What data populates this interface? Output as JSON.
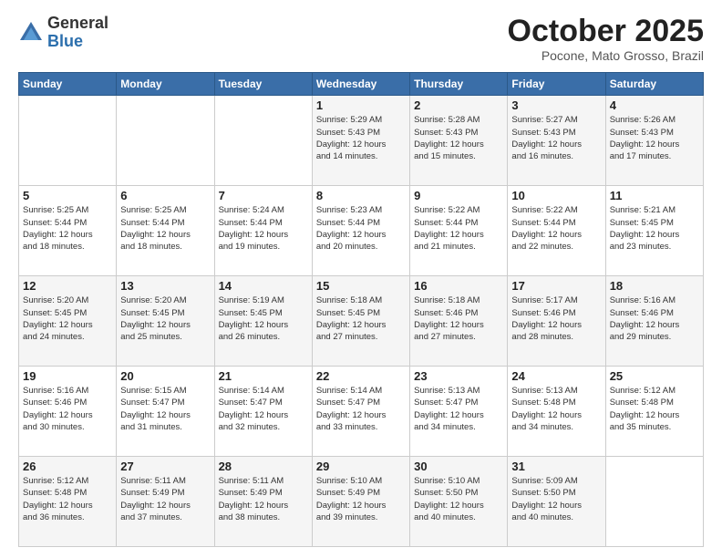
{
  "logo": {
    "general": "General",
    "blue": "Blue"
  },
  "header": {
    "month": "October 2025",
    "location": "Pocone, Mato Grosso, Brazil"
  },
  "weekdays": [
    "Sunday",
    "Monday",
    "Tuesday",
    "Wednesday",
    "Thursday",
    "Friday",
    "Saturday"
  ],
  "weeks": [
    [
      {
        "day": "",
        "info": ""
      },
      {
        "day": "",
        "info": ""
      },
      {
        "day": "",
        "info": ""
      },
      {
        "day": "1",
        "info": "Sunrise: 5:29 AM\nSunset: 5:43 PM\nDaylight: 12 hours\nand 14 minutes."
      },
      {
        "day": "2",
        "info": "Sunrise: 5:28 AM\nSunset: 5:43 PM\nDaylight: 12 hours\nand 15 minutes."
      },
      {
        "day": "3",
        "info": "Sunrise: 5:27 AM\nSunset: 5:43 PM\nDaylight: 12 hours\nand 16 minutes."
      },
      {
        "day": "4",
        "info": "Sunrise: 5:26 AM\nSunset: 5:43 PM\nDaylight: 12 hours\nand 17 minutes."
      }
    ],
    [
      {
        "day": "5",
        "info": "Sunrise: 5:25 AM\nSunset: 5:44 PM\nDaylight: 12 hours\nand 18 minutes."
      },
      {
        "day": "6",
        "info": "Sunrise: 5:25 AM\nSunset: 5:44 PM\nDaylight: 12 hours\nand 18 minutes."
      },
      {
        "day": "7",
        "info": "Sunrise: 5:24 AM\nSunset: 5:44 PM\nDaylight: 12 hours\nand 19 minutes."
      },
      {
        "day": "8",
        "info": "Sunrise: 5:23 AM\nSunset: 5:44 PM\nDaylight: 12 hours\nand 20 minutes."
      },
      {
        "day": "9",
        "info": "Sunrise: 5:22 AM\nSunset: 5:44 PM\nDaylight: 12 hours\nand 21 minutes."
      },
      {
        "day": "10",
        "info": "Sunrise: 5:22 AM\nSunset: 5:44 PM\nDaylight: 12 hours\nand 22 minutes."
      },
      {
        "day": "11",
        "info": "Sunrise: 5:21 AM\nSunset: 5:45 PM\nDaylight: 12 hours\nand 23 minutes."
      }
    ],
    [
      {
        "day": "12",
        "info": "Sunrise: 5:20 AM\nSunset: 5:45 PM\nDaylight: 12 hours\nand 24 minutes."
      },
      {
        "day": "13",
        "info": "Sunrise: 5:20 AM\nSunset: 5:45 PM\nDaylight: 12 hours\nand 25 minutes."
      },
      {
        "day": "14",
        "info": "Sunrise: 5:19 AM\nSunset: 5:45 PM\nDaylight: 12 hours\nand 26 minutes."
      },
      {
        "day": "15",
        "info": "Sunrise: 5:18 AM\nSunset: 5:45 PM\nDaylight: 12 hours\nand 27 minutes."
      },
      {
        "day": "16",
        "info": "Sunrise: 5:18 AM\nSunset: 5:46 PM\nDaylight: 12 hours\nand 27 minutes."
      },
      {
        "day": "17",
        "info": "Sunrise: 5:17 AM\nSunset: 5:46 PM\nDaylight: 12 hours\nand 28 minutes."
      },
      {
        "day": "18",
        "info": "Sunrise: 5:16 AM\nSunset: 5:46 PM\nDaylight: 12 hours\nand 29 minutes."
      }
    ],
    [
      {
        "day": "19",
        "info": "Sunrise: 5:16 AM\nSunset: 5:46 PM\nDaylight: 12 hours\nand 30 minutes."
      },
      {
        "day": "20",
        "info": "Sunrise: 5:15 AM\nSunset: 5:47 PM\nDaylight: 12 hours\nand 31 minutes."
      },
      {
        "day": "21",
        "info": "Sunrise: 5:14 AM\nSunset: 5:47 PM\nDaylight: 12 hours\nand 32 minutes."
      },
      {
        "day": "22",
        "info": "Sunrise: 5:14 AM\nSunset: 5:47 PM\nDaylight: 12 hours\nand 33 minutes."
      },
      {
        "day": "23",
        "info": "Sunrise: 5:13 AM\nSunset: 5:47 PM\nDaylight: 12 hours\nand 34 minutes."
      },
      {
        "day": "24",
        "info": "Sunrise: 5:13 AM\nSunset: 5:48 PM\nDaylight: 12 hours\nand 34 minutes."
      },
      {
        "day": "25",
        "info": "Sunrise: 5:12 AM\nSunset: 5:48 PM\nDaylight: 12 hours\nand 35 minutes."
      }
    ],
    [
      {
        "day": "26",
        "info": "Sunrise: 5:12 AM\nSunset: 5:48 PM\nDaylight: 12 hours\nand 36 minutes."
      },
      {
        "day": "27",
        "info": "Sunrise: 5:11 AM\nSunset: 5:49 PM\nDaylight: 12 hours\nand 37 minutes."
      },
      {
        "day": "28",
        "info": "Sunrise: 5:11 AM\nSunset: 5:49 PM\nDaylight: 12 hours\nand 38 minutes."
      },
      {
        "day": "29",
        "info": "Sunrise: 5:10 AM\nSunset: 5:49 PM\nDaylight: 12 hours\nand 39 minutes."
      },
      {
        "day": "30",
        "info": "Sunrise: 5:10 AM\nSunset: 5:50 PM\nDaylight: 12 hours\nand 40 minutes."
      },
      {
        "day": "31",
        "info": "Sunrise: 5:09 AM\nSunset: 5:50 PM\nDaylight: 12 hours\nand 40 minutes."
      },
      {
        "day": "",
        "info": ""
      }
    ]
  ]
}
